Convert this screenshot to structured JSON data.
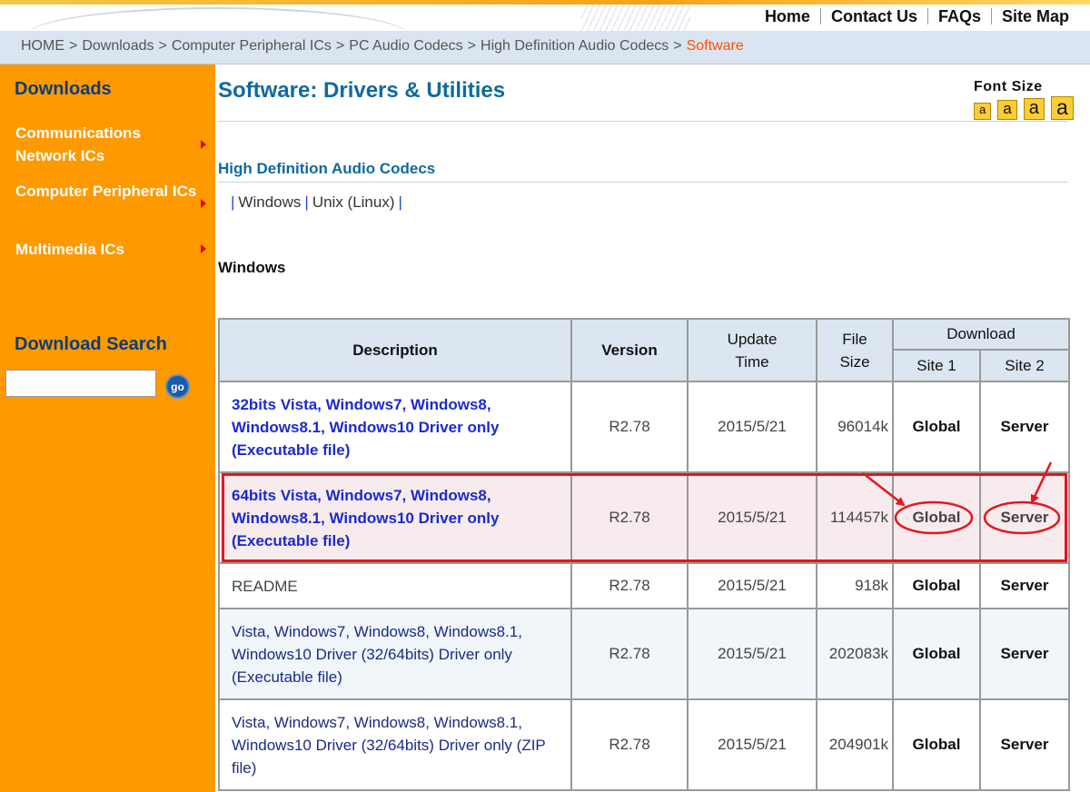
{
  "topnav": {
    "items": [
      "Home",
      "Contact Us",
      "FAQs",
      "Site Map"
    ]
  },
  "breadcrumb": {
    "items": [
      "HOME",
      "Downloads",
      "Computer Peripheral ICs",
      "PC Audio Codecs",
      "High Definition Audio Codecs"
    ],
    "current": "Software",
    "separator": ">"
  },
  "sidebar": {
    "title": "Downloads",
    "items": [
      {
        "label": "Communications Network ICs"
      },
      {
        "label": "Computer Peripheral ICs"
      },
      {
        "label": "Multimedia ICs"
      }
    ],
    "search_title": "Download Search",
    "search_placeholder": "",
    "go_label": "go"
  },
  "main": {
    "title": "Software: Drivers & Utilities",
    "font_size": {
      "label": "Font Size",
      "buttons": [
        "a",
        "a",
        "a",
        "a"
      ]
    },
    "section_title": "High Definition Audio Codecs",
    "os_links": {
      "separator": "|",
      "items": [
        "Windows",
        "Unix (Linux)"
      ]
    },
    "subheading": "Windows"
  },
  "table": {
    "headers": {
      "description": "Description",
      "version": "Version",
      "update_time": "Update Time",
      "file_size": "File Size",
      "download": "Download",
      "site1": "Site 1",
      "site2": "Site 2"
    },
    "rows": [
      {
        "description": "32bits Vista, Windows7, Windows8, Windows8.1, Windows10 Driver only (Executable file)",
        "version": "R2.78",
        "update_time": "2015/5/21",
        "file_size": "96014k",
        "site1": "Global",
        "site2": "Server"
      },
      {
        "description": "64bits Vista, Windows7, Windows8, Windows8.1, Windows10 Driver only (Executable file)",
        "version": "R2.78",
        "update_time": "2015/5/21",
        "file_size": "114457k",
        "site1": "Global",
        "site2": "Server"
      },
      {
        "description": "README",
        "version": "R2.78",
        "update_time": "2015/5/21",
        "file_size": "918k",
        "site1": "Global",
        "site2": "Server"
      },
      {
        "description": "Vista, Windows7, Windows8, Windows8.1, Windows10 Driver (32/64bits) Driver only (Executable file)",
        "version": "R2.78",
        "update_time": "2015/5/21",
        "file_size": "202083k",
        "site1": "Global",
        "site2": "Server"
      },
      {
        "description": "Vista, Windows7, Windows8, Windows8.1, Windows10 Driver (32/64bits) Driver only (ZIP file)",
        "version": "R2.78",
        "update_time": "2015/5/21",
        "file_size": "204901k",
        "site1": "Global",
        "site2": "Server"
      }
    ]
  },
  "colors": {
    "sidebar_bg": "#ff9900",
    "title_blue": "#0e6aa0",
    "breadcrumb_current": "#ff4f00",
    "annotation_red": "#e8141e"
  }
}
